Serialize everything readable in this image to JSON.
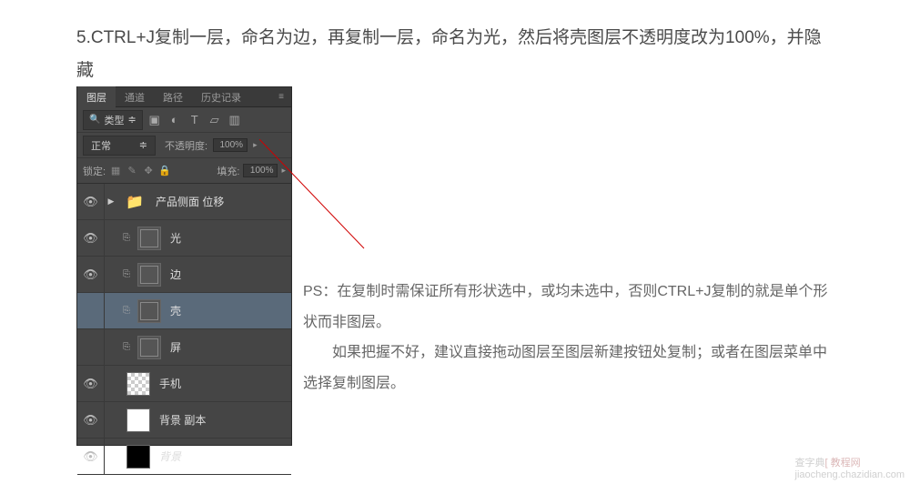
{
  "instruction": "5.CTRL+J复制一层，命名为边，再复制一层，命名为光，然后将壳图层不透明度改为100%，并隐藏",
  "panel": {
    "tabs": [
      "图层",
      "通道",
      "路径",
      "历史记录"
    ],
    "active_tab_index": 0,
    "filter": {
      "label": "类型",
      "icons": [
        "image",
        "adjust",
        "text",
        "shape",
        "smart"
      ]
    },
    "blend": {
      "mode": "正常",
      "opacity_label": "不透明度:",
      "opacity_value": "100%"
    },
    "lock": {
      "label": "锁定:",
      "fill_label": "填充:",
      "fill_value": "100%"
    },
    "layers": [
      {
        "name": "产品侧面 位移",
        "type": "group",
        "visible": true,
        "selected": false,
        "expand": "▶"
      },
      {
        "name": "光",
        "type": "shape",
        "visible": true,
        "selected": false
      },
      {
        "name": "边",
        "type": "shape",
        "visible": true,
        "selected": false
      },
      {
        "name": "壳",
        "type": "shape",
        "visible": false,
        "selected": true
      },
      {
        "name": "屏",
        "type": "shape",
        "visible": false,
        "selected": false
      },
      {
        "name": "手机",
        "type": "checker",
        "visible": true,
        "selected": false
      },
      {
        "name": "背景 副本",
        "type": "white",
        "visible": true,
        "selected": false
      },
      {
        "name": "背景",
        "type": "black",
        "visible": true,
        "selected": false,
        "italic": true
      }
    ]
  },
  "note": {
    "p1": "PS：在复制时需保证所有形状选中，或均未选中，否则CTRL+J复制的就是单个形状而非图层。",
    "p2": "如果把握不好，建议直接拖动图层至图层新建按钮处复制；或者在图层菜单中选择复制图层。"
  },
  "watermark": {
    "text1": "查字典",
    "text2": "[ 教程网",
    "url": "jiaocheng.chazidian.com"
  }
}
